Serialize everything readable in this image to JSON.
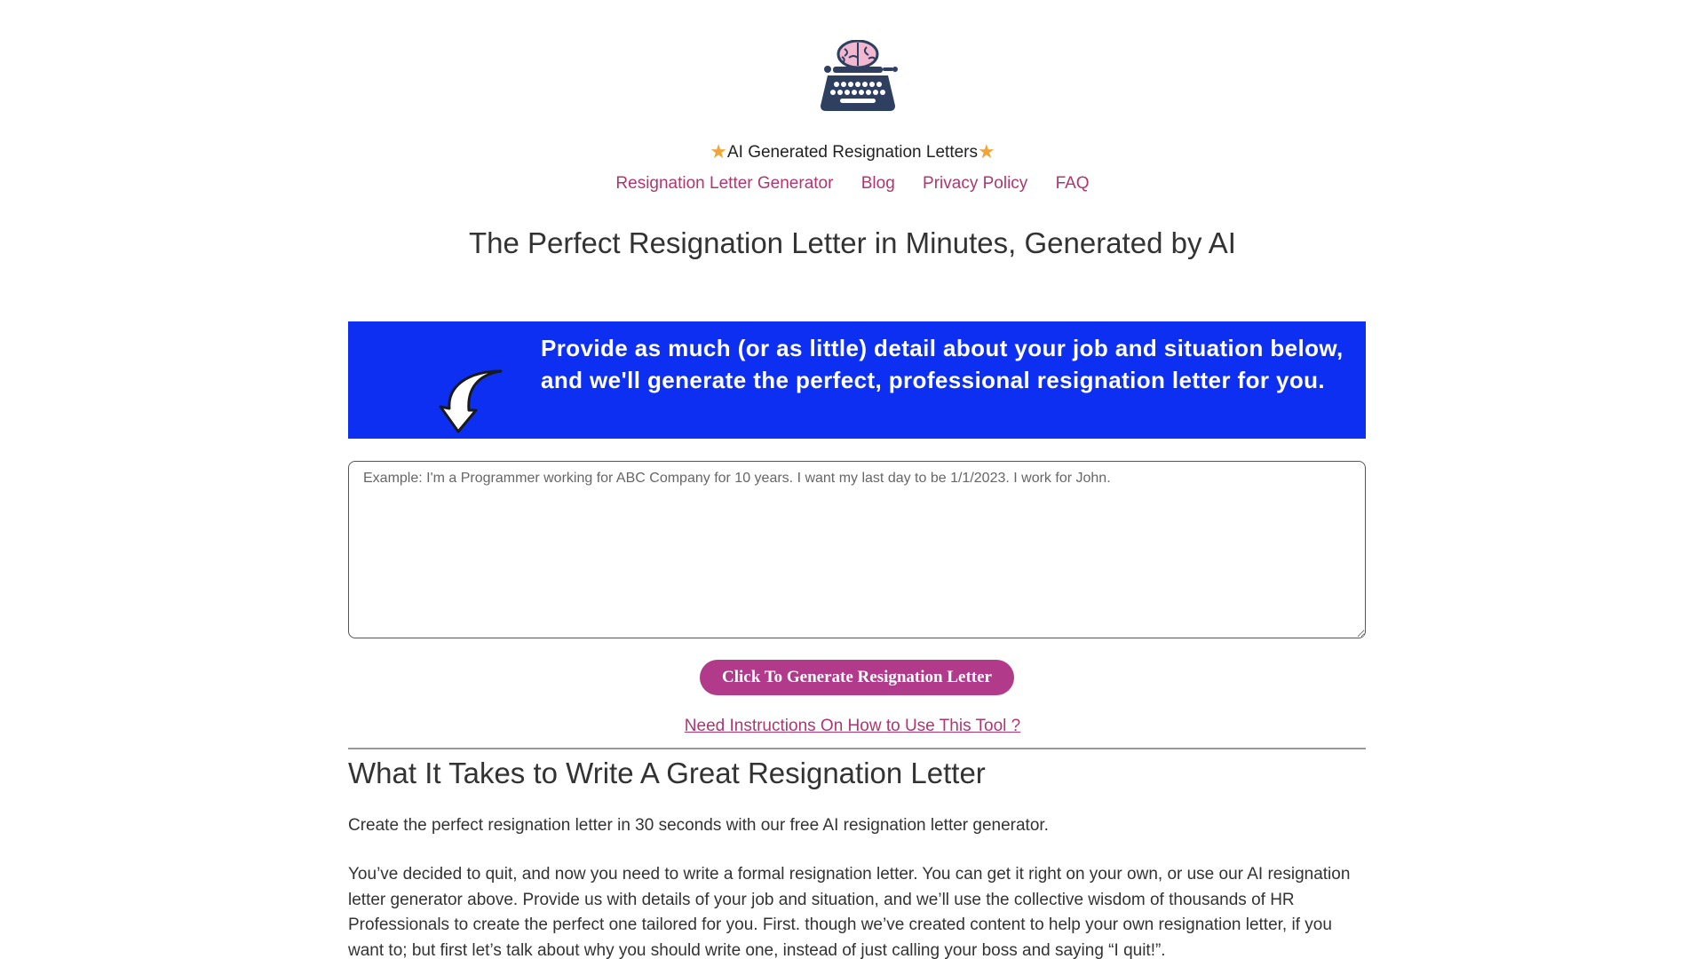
{
  "header": {
    "tagline_star_left": "★",
    "tagline_text": "AI Generated Resignation Letters",
    "tagline_star_right": "★",
    "logo_icon": "brain-typewriter-icon"
  },
  "nav": {
    "items": [
      {
        "label": "Resignation Letter Generator"
      },
      {
        "label": "Blog"
      },
      {
        "label": "Privacy Policy"
      },
      {
        "label": "FAQ"
      }
    ]
  },
  "headline": "The Perfect Resignation Letter in Minutes, Generated by AI",
  "banner": {
    "text": "Provide as much (or as little) detail about your job and situation below, and we'll generate the perfect, professional resignation letter for you.",
    "background": "#0d2ff2",
    "arrow_icon": "curved-down-arrow-icon"
  },
  "form": {
    "placeholder": "Example: I'm a Programmer working for ABC Company for 10 years. I want my last day to be 1/1/2023. I work for John.",
    "value": "",
    "submit_label": "Click To Generate Resignation Letter",
    "button_color": "#b23a8a"
  },
  "instructions_link": "Need Instructions On How to Use This Tool ?",
  "content": {
    "title": "What It Takes to Write A Great Resignation Letter",
    "paragraphs": [
      "Create the perfect resignation letter in 30 seconds with our free AI resignation letter generator.",
      "You’ve decided to quit, and now you need to write a formal resignation letter. You can get it right on your own, or use our AI resignation letter generator above. Provide us with details of your job and situation, and we’ll use the collective wisdom of thousands of HR Professionals to create the perfect one tailored for you. First. though we’ve created content to help your own resignation letter, if you want to; but first let’s talk about why you should write one, instead of just calling your boss and saying “I quit!”."
    ]
  },
  "colors": {
    "link": "#b0366f",
    "star": "#f0a53a",
    "text": "#333333"
  }
}
